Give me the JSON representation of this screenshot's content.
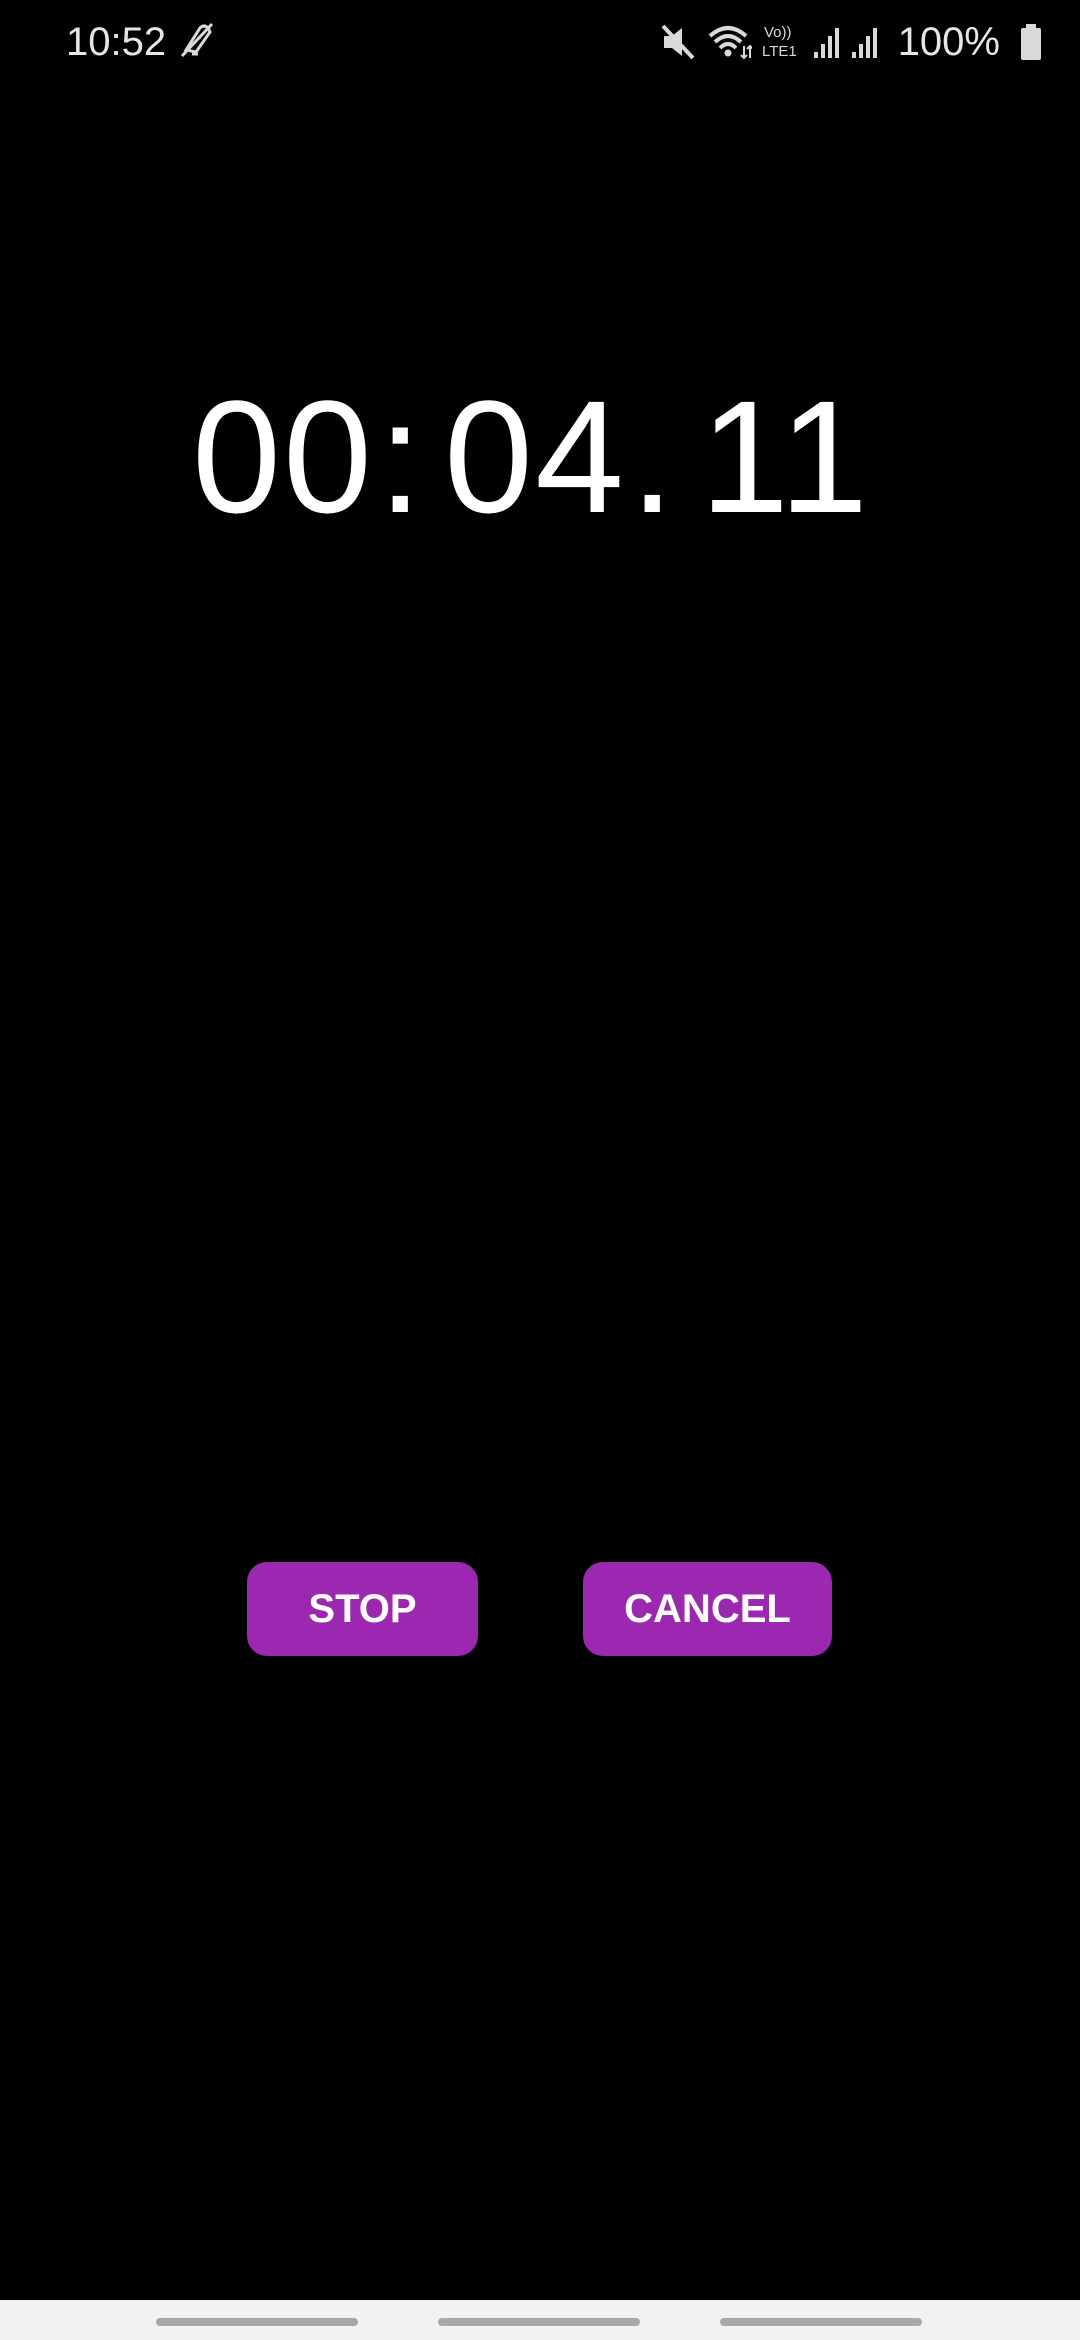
{
  "status_bar": {
    "time": "10:52",
    "left_icons": [
      "notification-off-icon"
    ],
    "right_icons": [
      "mute-icon",
      "wifi-icon",
      "volte-lte1-icon",
      "signal-sim1-icon",
      "signal-sim2-icon",
      "battery-icon"
    ],
    "volte_label_top": "Vo))",
    "volte_label_bottom": "LTE1",
    "battery_percent": "100%"
  },
  "timer": {
    "minutes": "00",
    "colon": ":",
    "seconds": "04",
    "dot": ".",
    "hundredths": "11"
  },
  "actions": {
    "stop_label": "STOP",
    "cancel_label": "CANCEL"
  },
  "colors": {
    "background": "#000000",
    "accent": "#9c27b0",
    "text": "#ffffff",
    "nav_bar": "#f2f2f2"
  }
}
